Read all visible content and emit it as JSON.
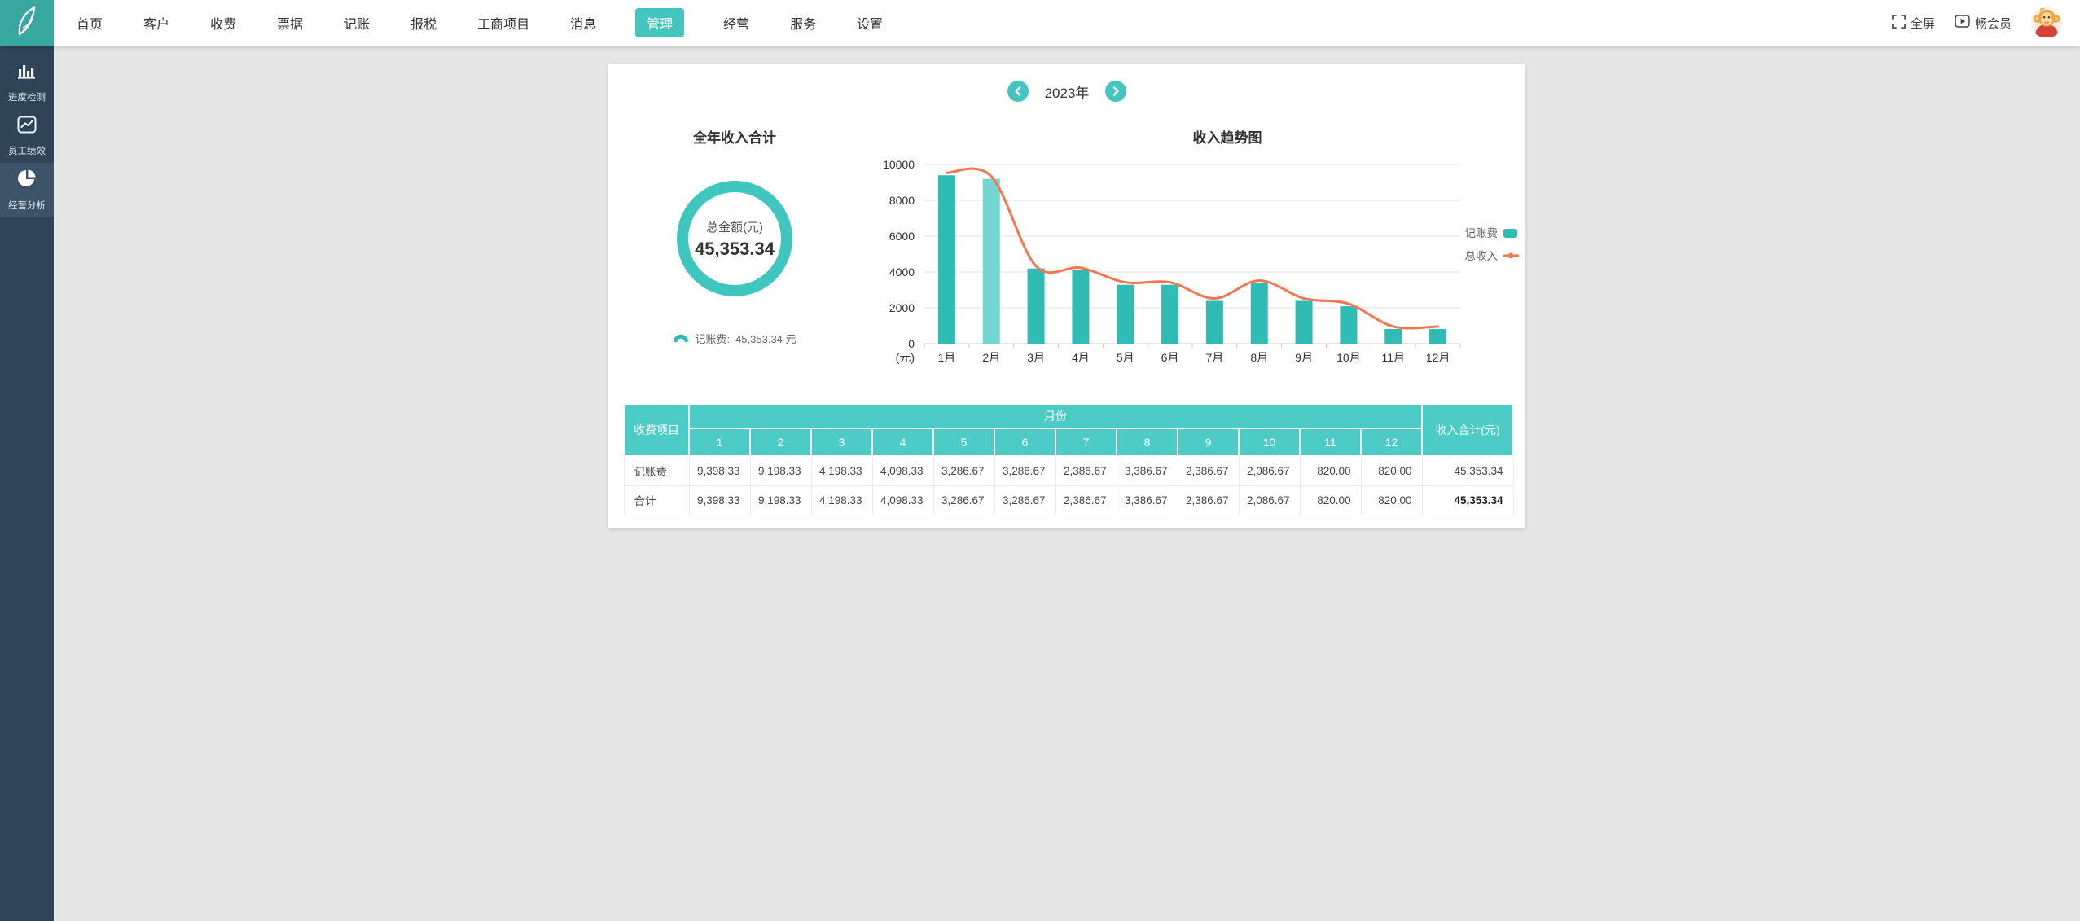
{
  "navbar": {
    "menu": [
      {
        "name": "home",
        "label": "首页",
        "active": false
      },
      {
        "name": "customers",
        "label": "客户",
        "active": false
      },
      {
        "name": "fees",
        "label": "收费",
        "active": false
      },
      {
        "name": "invoices",
        "label": "票据",
        "active": false
      },
      {
        "name": "bookkeeping",
        "label": "记账",
        "active": false
      },
      {
        "name": "tax-filing",
        "label": "报税",
        "active": false
      },
      {
        "name": "business-projects",
        "label": "工商项目",
        "active": false
      },
      {
        "name": "messages",
        "label": "消息",
        "active": false
      },
      {
        "name": "management",
        "label": "管理",
        "active": true
      },
      {
        "name": "operations",
        "label": "经营",
        "active": false
      },
      {
        "name": "services",
        "label": "服务",
        "active": false
      },
      {
        "name": "settings",
        "label": "设置",
        "active": false
      }
    ],
    "fullscreen_label": "全屏",
    "member_label": "畅会员"
  },
  "sidebar": {
    "items": [
      {
        "name": "progress-monitor",
        "label": "进度检测",
        "icon": "bar-chart-icon",
        "active": false
      },
      {
        "name": "employee-performance",
        "label": "员工绩效",
        "icon": "line-chart-icon",
        "active": false
      },
      {
        "name": "business-analysis",
        "label": "经营分析",
        "icon": "pie-chart-icon",
        "active": true
      }
    ]
  },
  "year_selector": {
    "year": "2023年"
  },
  "annual_summary": {
    "title": "全年收入合计",
    "donut_label": "总金额(元)",
    "donut_value": "45,353.34",
    "legend_label": "记账费:",
    "legend_value": "45,353.34 元"
  },
  "chart_data": {
    "type": "bar",
    "title": "收入趋势图",
    "categories": [
      "1月",
      "2月",
      "3月",
      "4月",
      "5月",
      "6月",
      "7月",
      "8月",
      "9月",
      "10月",
      "11月",
      "12月"
    ],
    "series": [
      {
        "name": "记账费",
        "type": "bar",
        "values": [
          9398.33,
          9198.33,
          4198.33,
          4098.33,
          3286.67,
          3286.67,
          2386.67,
          3386.67,
          2386.67,
          2086.67,
          820.0,
          820.0
        ]
      },
      {
        "name": "总收入",
        "type": "line",
        "values": [
          9398.33,
          9198.33,
          4198.33,
          4098.33,
          3286.67,
          3286.67,
          2386.67,
          3386.67,
          2386.67,
          2086.67,
          820.0,
          820.0
        ]
      }
    ],
    "ylim": [
      0,
      10000
    ],
    "yticks": [
      0,
      2000,
      4000,
      6000,
      8000,
      10000
    ],
    "y_unit": "(元)",
    "legend_position": "right",
    "grid": true,
    "highlight_bar_index": 1
  },
  "table": {
    "corner_header": "收费项目",
    "group_header": "月份",
    "month_headers": [
      "1",
      "2",
      "3",
      "4",
      "5",
      "6",
      "7",
      "8",
      "9",
      "10",
      "11",
      "12"
    ],
    "total_header": "收入合计(元)",
    "rows": [
      {
        "label": "记账费",
        "values": [
          "9,398.33",
          "9,198.33",
          "4,198.33",
          "4,098.33",
          "3,286.67",
          "3,286.67",
          "2,386.67",
          "3,386.67",
          "2,386.67",
          "2,086.67",
          "820.00",
          "820.00"
        ],
        "total": "45,353.34",
        "total_bold": false
      },
      {
        "label": "合计",
        "values": [
          "9,398.33",
          "9,198.33",
          "4,198.33",
          "4,098.33",
          "3,286.67",
          "3,286.67",
          "2,386.67",
          "3,386.67",
          "2,386.67",
          "2,086.67",
          "820.00",
          "820.00"
        ],
        "total": "45,353.34",
        "total_bold": true
      }
    ]
  },
  "colors": {
    "accent_teal": "#2fbcb5",
    "bar_highlight": "#74d6d0",
    "line_orange": "#f5764e",
    "table_header_teal": "#4ccbc7",
    "navbar_active_teal": "#44c5c0",
    "sidebar_bg": "#2f4457",
    "grid_gray": "#e0e0e0",
    "axis_gray": "#c9c9c9"
  }
}
